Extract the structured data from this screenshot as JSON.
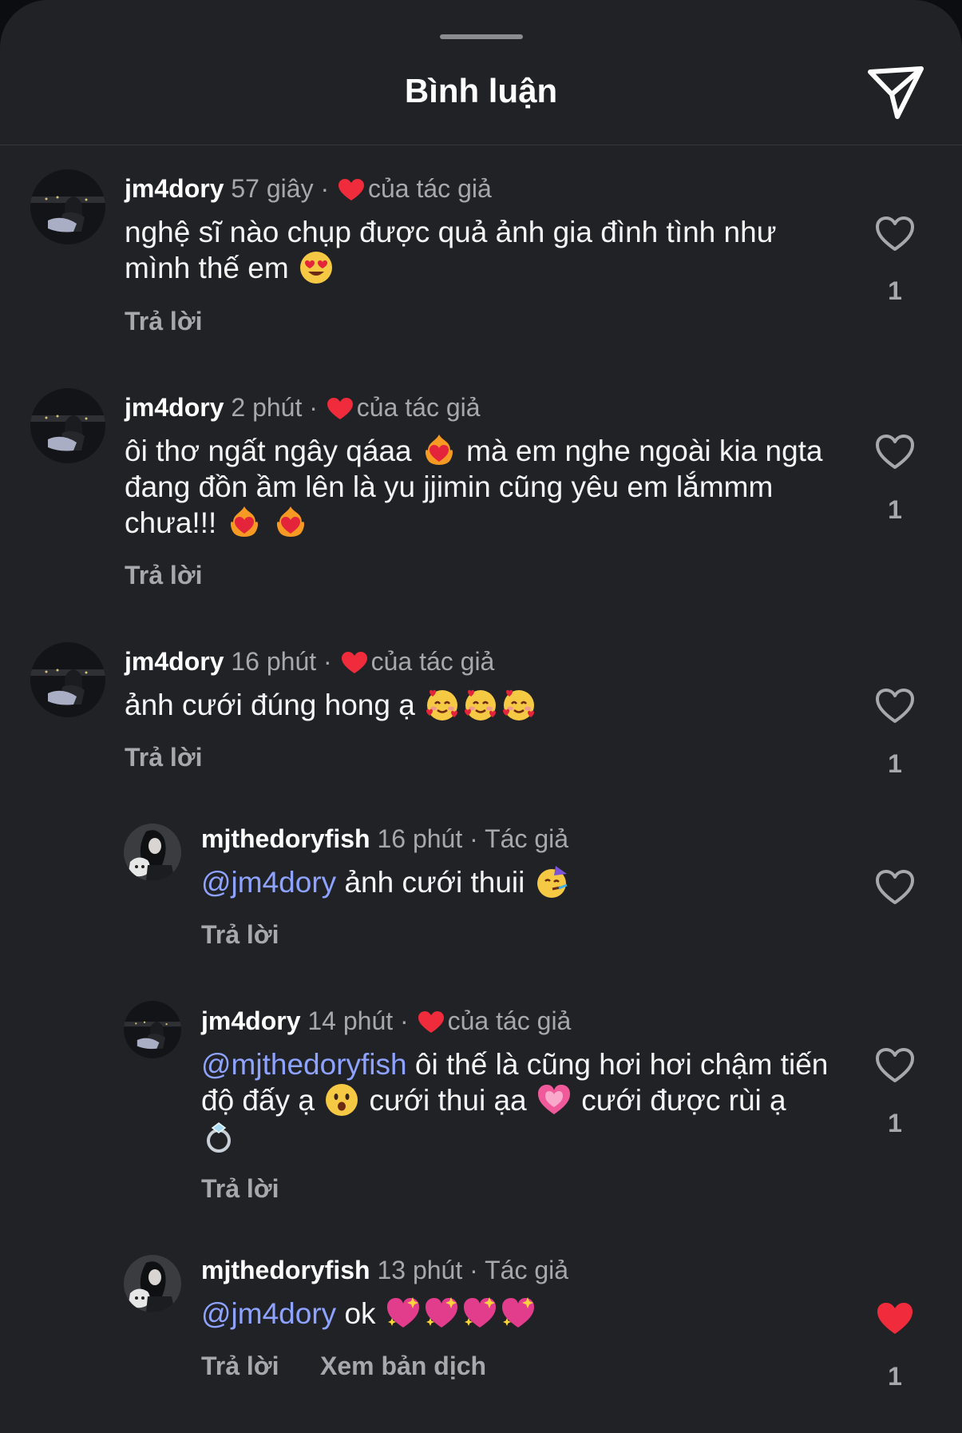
{
  "header": {
    "title": "Bình luận",
    "share_icon": "send-paper-plane-icon"
  },
  "colors": {
    "background": "#202226",
    "mention": "#8ea2ff",
    "heart": "#ef2b3c",
    "muted": "#a6a8ad"
  },
  "comments": [
    {
      "user": "jm4dory",
      "time": "57 giây",
      "sep": "·",
      "author_tag": "của tác giả",
      "text": "nghệ sĩ nào chụp được quả ảnh gia đình tình như mình thế em",
      "emoji": "heart-eyes-emoji",
      "reply": "Trả lời",
      "likes": "1",
      "liked": false
    },
    {
      "user": "jm4dory",
      "time": "2 phút",
      "sep": "·",
      "author_tag": "của tác giả",
      "text_1": "ôi thơ ngất ngây qáaa",
      "text_2": "mà em nghe ngoài kia ngta đang đồn ầm lên là yu jjimin cũng yêu em lắmmm chưa!!!",
      "emoji": "heart-on-fire-emoji",
      "reply": "Trả lời",
      "likes": "1",
      "liked": false
    },
    {
      "user": "jm4dory",
      "time": "16 phút",
      "sep": "·",
      "author_tag": "của tác giả",
      "text": "ảnh cưới đúng hong ạ",
      "emoji": "smiling-face-with-hearts-emoji",
      "reply": "Trả lời",
      "likes": "1",
      "liked": false
    },
    {
      "user": "mjthedoryfish",
      "time": "16 phút",
      "sep": "·",
      "author_tag": "Tác giả",
      "mention": "@jm4dory",
      "text": "ảnh cưới thuii",
      "emoji": "partying-face-emoji",
      "reply": "Trả lời",
      "likes": "",
      "liked": false
    },
    {
      "user": "jm4dory",
      "time": "14 phút",
      "sep": "·",
      "author_tag": "của tác giả",
      "mention": "@mjthedoryfish",
      "text_1": "ôi thế là cũng hơi hơi chậm tiến độ đấy ạ",
      "text_2": "cưới thui ạa",
      "text_3": "cưới được rùi ạ",
      "emoji_1": "hushed-face-emoji",
      "emoji_2": "growing-heart-emoji",
      "emoji_3": "ring-emoji",
      "reply": "Trả lời",
      "likes": "1",
      "liked": false
    },
    {
      "user": "mjthedoryfish",
      "time": "13 phút",
      "sep": "·",
      "author_tag": "Tác giả",
      "mention": "@jm4dory",
      "text": "ok",
      "emoji": "sparkling-heart-emoji",
      "reply": "Trả lời",
      "translate": "Xem bản dịch",
      "likes": "1",
      "liked": true
    }
  ]
}
